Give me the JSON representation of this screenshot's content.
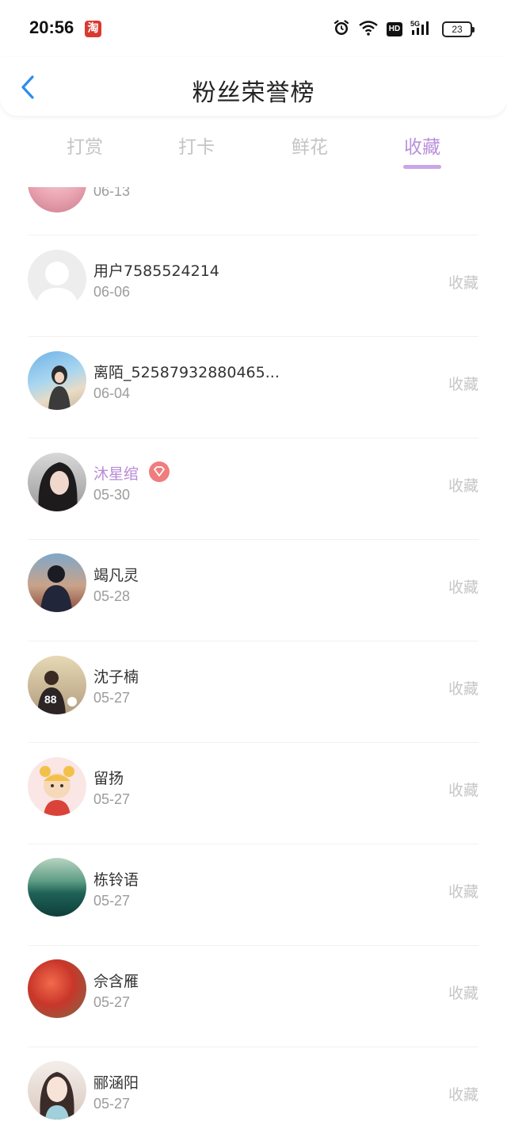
{
  "status_bar": {
    "time": "20:56",
    "app_badge": "淘",
    "hd": "HD",
    "network": "5G",
    "battery": "23",
    "icons": [
      "alarm-icon",
      "wifi-icon",
      "hd-icon",
      "signal-5g-icon",
      "battery-icon"
    ]
  },
  "header": {
    "title": "粉丝荣誉榜",
    "back_icon": "chevron-left-icon"
  },
  "tabs": [
    {
      "label": "打赏",
      "active": false
    },
    {
      "label": "打卡",
      "active": false
    },
    {
      "label": "鲜花",
      "active": false
    },
    {
      "label": "收藏",
      "active": true
    }
  ],
  "colors": {
    "accent": "#b990dc",
    "back_arrow": "#2d8cf0",
    "vip_name": "#b98ad8",
    "muted": "#c6c6c6",
    "date": "#9c9c9c"
  },
  "fans": [
    {
      "name": "",
      "date": "06-13",
      "action": "",
      "partial": true
    },
    {
      "name": "用户7585524214",
      "date": "06-06",
      "action": "收藏"
    },
    {
      "name": "离陌_52587932880465...",
      "date": "06-04",
      "action": "收藏"
    },
    {
      "name": "沐星绾",
      "date": "05-30",
      "action": "收藏",
      "vip": true
    },
    {
      "name": "竭凡灵",
      "date": "05-28",
      "action": "收藏"
    },
    {
      "name": "沈子楠",
      "date": "05-27",
      "action": "收藏"
    },
    {
      "name": "留扬",
      "date": "05-27",
      "action": "收藏"
    },
    {
      "name": "栋铃语",
      "date": "05-27",
      "action": "收藏"
    },
    {
      "name": "佘含雁",
      "date": "05-27",
      "action": "收藏"
    },
    {
      "name": "郦涵阳",
      "date": "05-27",
      "action": "收藏"
    }
  ]
}
